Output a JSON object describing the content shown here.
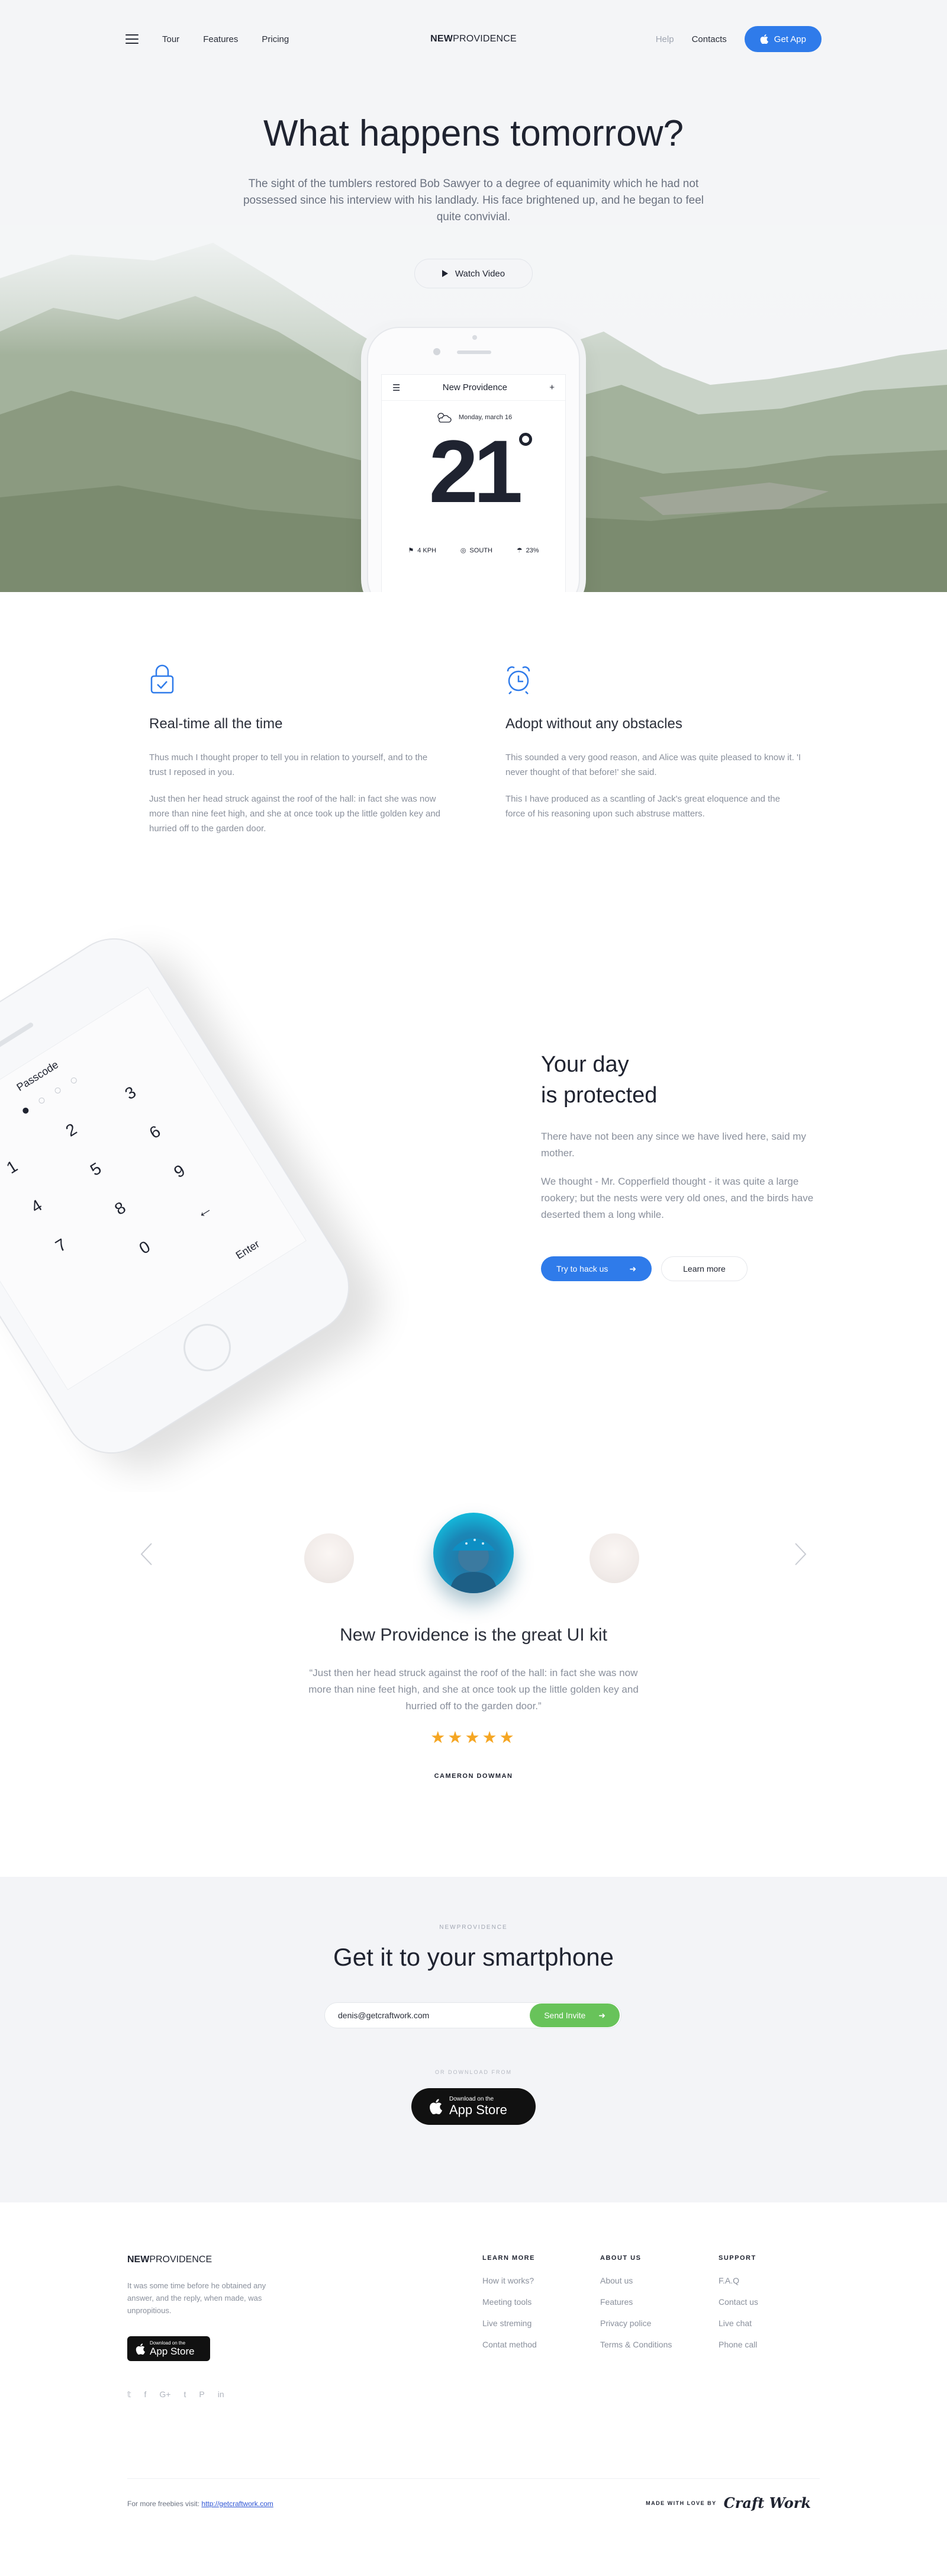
{
  "nav": {
    "links": [
      "Tour",
      "Features",
      "Pricing"
    ],
    "brand_bold": "NEW",
    "brand_rest": "PROVIDENCE",
    "help": "Help",
    "contacts": "Contacts",
    "get_app": "Get App"
  },
  "hero": {
    "title": "What happens tomorrow?",
    "lead": "The sight of the tumblers restored Bob Sawyer to a degree of equanimity which he had not possessed since his interview with his landlady. His face brightened up, and he began to feel quite convivial.",
    "watch_video": "Watch Video",
    "phone": {
      "app_title": "New Providence",
      "date": "Monday, march 16",
      "temperature": "21",
      "wind": "4 KPH",
      "direction": "SOUTH",
      "humidity": "23%"
    }
  },
  "features": [
    {
      "icon": "lock-icon",
      "title": "Real-time all the time",
      "p1": "Thus much I thought proper to tell you in relation to yourself, and to the trust I reposed in you.",
      "p2": "Just then her head struck against the roof of the hall: in fact she was now more than nine feet high, and she at once took up the little golden key and hurried off to the garden door."
    },
    {
      "icon": "alarm-clock-icon",
      "title": "Adopt without any obstacles",
      "p1": "This sounded a very good reason, and Alice was quite pleased to know it. 'I never thought of that before!' she said.",
      "p2": "This I have produced as a scantling of Jack's great eloquence and the force of his reasoning upon such abstruse matters."
    }
  ],
  "protected": {
    "title_line1": "Your day",
    "title_line2": "is protected",
    "p1": "There have not been any since we have lived here, said my mother.",
    "p2": "We thought - Mr. Copperfield thought - it was quite a large rookery; but the nests were very old ones, and the birds have deserted them a long while.",
    "primary": "Try to hack us",
    "secondary": "Learn more",
    "phone": {
      "title": "Passcode",
      "keys": [
        "1",
        "2",
        "3",
        "4",
        "5",
        "6",
        "7",
        "8",
        "9",
        "",
        "0",
        "←"
      ],
      "enter": "Enter"
    }
  },
  "testimonial": {
    "title": "New Providence is the great UI kit",
    "quote": "“Just then her head struck against the roof of the hall: in fact she was now more than nine feet high, and she at once took up the little golden key and hurried off to the garden door.”",
    "rating": 5,
    "stars": "★★★★★",
    "author": "CAMERON DOWMAN"
  },
  "getit": {
    "kicker": "NEWPROVIDENCE",
    "title": "Get it to your smartphone",
    "email": "denis@getcraftwork.com",
    "send": "Send Invite",
    "or": "OR DOWNLOAD FROM",
    "appstore_small": "Download on the",
    "appstore_big": "App Store"
  },
  "footer": {
    "brand_bold": "NEW",
    "brand_rest": "PROVIDENCE",
    "about": "It was some time before he obtained any answer, and the reply, when made, was unpropitious.",
    "appstore_small": "Download on the",
    "appstore_big": "App Store",
    "socials": [
      "twitter-icon",
      "facebook-icon",
      "google-plus-icon",
      "tumblr-icon",
      "pinterest-icon",
      "linkedin-icon"
    ],
    "social_glyphs": [
      "𝕥",
      "f",
      "G+",
      "t",
      "P",
      "in"
    ],
    "columns": [
      {
        "title": "LEARN MORE",
        "links": [
          "How it works?",
          "Meeting tools",
          "Live streming",
          "Contat method"
        ]
      },
      {
        "title": "ABOUT US",
        "links": [
          "About us",
          "Features",
          "Privacy police",
          "Terms & Conditions"
        ]
      },
      {
        "title": "SUPPORT",
        "links": [
          "F.A.Q",
          "Contact us",
          "Live chat",
          "Phone call"
        ]
      }
    ],
    "freebies_text": "For more freebies visit:",
    "freebies_link": "http://getcraftwork.com",
    "made_with": "MADE WITH LOVE BY",
    "made_logo": "Craft Work"
  },
  "colors": {
    "accent": "#2f7bea",
    "green": "#68c35a",
    "star": "#f5a623"
  }
}
